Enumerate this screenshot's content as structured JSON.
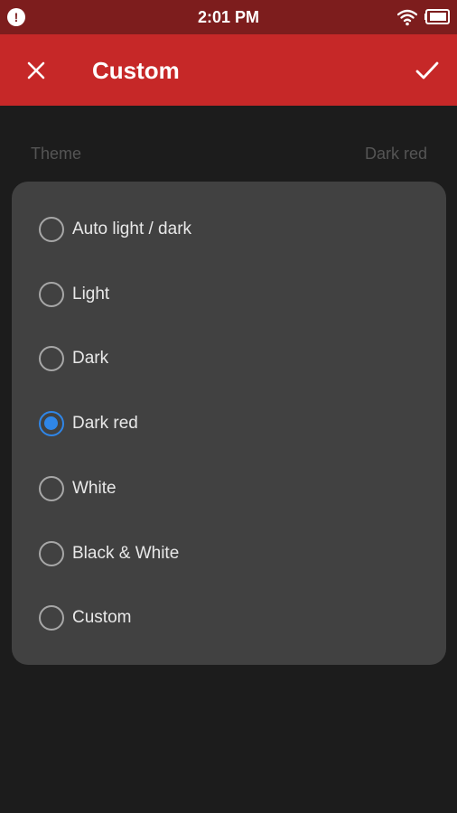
{
  "status_bar": {
    "time": "2:01 PM",
    "alert_glyph": "!",
    "icons": [
      "alert-icon",
      "wifi-icon",
      "battery-icon"
    ]
  },
  "app_bar": {
    "title": "Custom",
    "close_icon": "close-icon",
    "confirm_icon": "check-icon",
    "background": "#c62828"
  },
  "setting": {
    "label": "Theme",
    "value": "Dark red"
  },
  "theme_options": [
    {
      "label": "Auto light / dark",
      "selected": false
    },
    {
      "label": "Light",
      "selected": false
    },
    {
      "label": "Dark",
      "selected": false
    },
    {
      "label": "Dark red",
      "selected": true
    },
    {
      "label": "White",
      "selected": false
    },
    {
      "label": "Black & White",
      "selected": false
    },
    {
      "label": "Custom",
      "selected": false
    }
  ],
  "colors": {
    "accent": "#2f86e8",
    "status_bar": "#7d1d1d",
    "background": "#1c1c1c",
    "dialog": "#414141"
  }
}
